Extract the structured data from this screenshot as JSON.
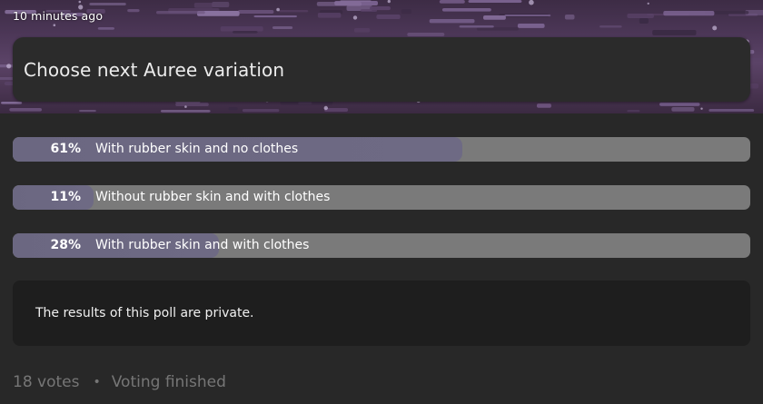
{
  "header": {
    "timestamp": "10 minutes ago",
    "title": "Choose next Auree variation"
  },
  "options": [
    {
      "percent_label": "61%",
      "label": "With rubber skin and no clothes",
      "fraction": 0.61
    },
    {
      "percent_label": "11%",
      "label": "Without rubber skin and with clothes",
      "fraction": 0.11
    },
    {
      "percent_label": "28%",
      "label": "With rubber skin and with clothes",
      "fraction": 0.28
    }
  ],
  "notice": {
    "text": "The results of this poll are private."
  },
  "footer": {
    "votes": "18 votes",
    "separator": "•",
    "status": "Voting finished"
  },
  "colors": {
    "background": "#282828",
    "bar_track": "#7a7a7a",
    "bar_fill": "#6b6781",
    "banner_purple": "#4b3656"
  }
}
